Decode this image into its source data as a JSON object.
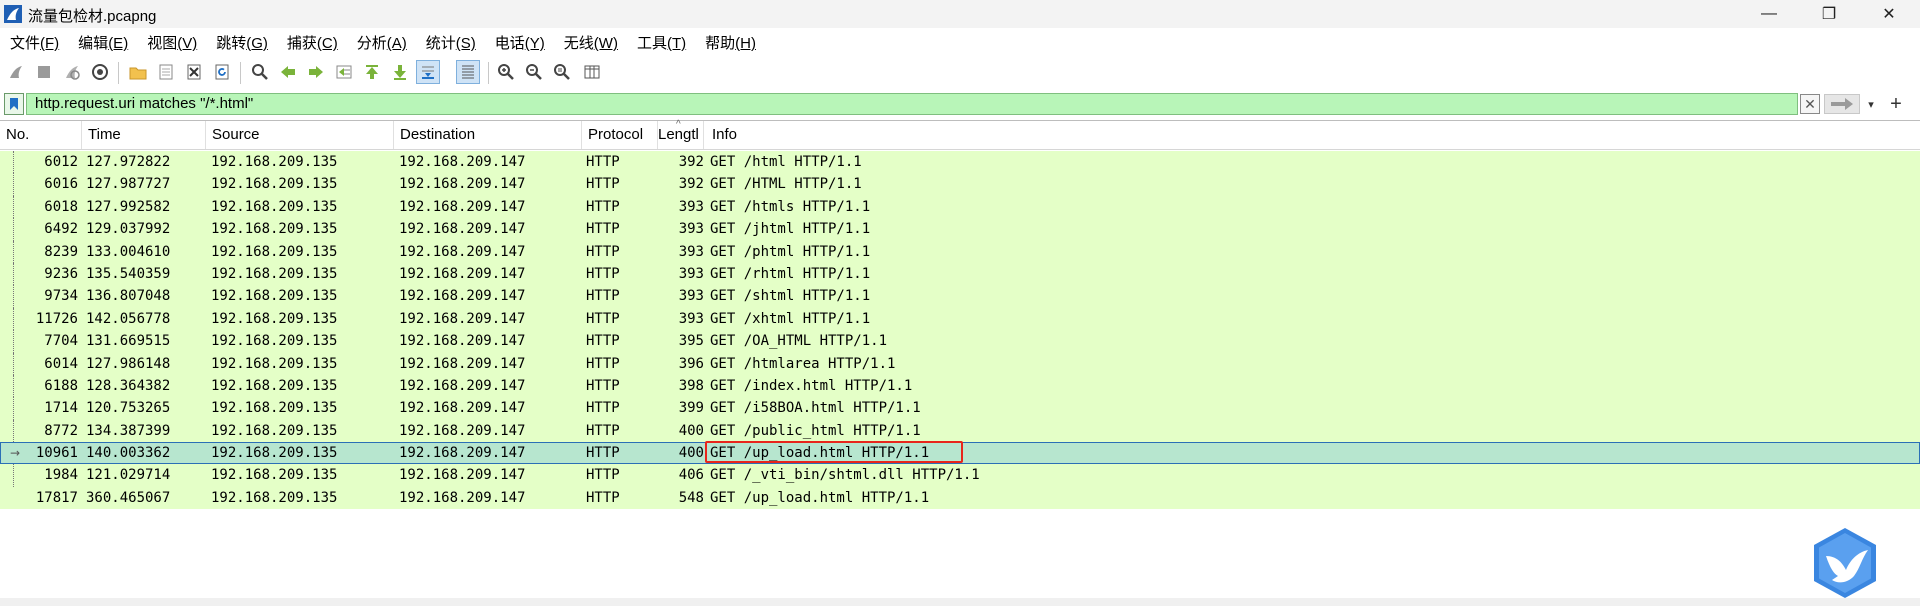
{
  "window": {
    "title": "流量包检材.pcapng",
    "controls": {
      "minimize": "—",
      "maximize": "❐",
      "close": "✕"
    }
  },
  "menu": [
    {
      "label": "文件",
      "mnemonic": "(F)"
    },
    {
      "label": "编辑",
      "mnemonic": "(E)"
    },
    {
      "label": "视图",
      "mnemonic": "(V)"
    },
    {
      "label": "跳转",
      "mnemonic": "(G)"
    },
    {
      "label": "捕获",
      "mnemonic": "(C)"
    },
    {
      "label": "分析",
      "mnemonic": "(A)"
    },
    {
      "label": "统计",
      "mnemonic": "(S)"
    },
    {
      "label": "电话",
      "mnemonic": "(Y)"
    },
    {
      "label": "无线",
      "mnemonic": "(W)"
    },
    {
      "label": "工具",
      "mnemonic": "(T)"
    },
    {
      "label": "帮助",
      "mnemonic": "(H)"
    }
  ],
  "toolbar": {
    "icons": [
      "start-capture-icon",
      "stop-capture-icon",
      "restart-capture-icon",
      "capture-options-icon",
      "open-file-icon",
      "save-file-icon",
      "close-file-icon",
      "reload-icon",
      "find-packet-icon",
      "go-back-icon",
      "go-forward-icon",
      "go-to-packet-icon",
      "go-first-icon",
      "go-last-icon",
      "autoscroll-icon",
      "colorize-icon",
      "zoom-in-icon",
      "zoom-out-icon",
      "normal-size-icon",
      "resize-columns-icon"
    ]
  },
  "filter": {
    "value": "http.request.uri matches \"/*.html\"",
    "clear_label": "✕",
    "plus_label": "+"
  },
  "packet_list": {
    "columns": [
      "No.",
      "Time",
      "Source",
      "Destination",
      "Protocol",
      "Lengtl",
      "Info"
    ],
    "rows": [
      {
        "no": "6012",
        "time": "127.972822",
        "src": "192.168.209.135",
        "dst": "192.168.209.147",
        "proto": "HTTP",
        "len": "392",
        "info": "GET /html HTTP/1.1"
      },
      {
        "no": "6016",
        "time": "127.987727",
        "src": "192.168.209.135",
        "dst": "192.168.209.147",
        "proto": "HTTP",
        "len": "392",
        "info": "GET /HTML HTTP/1.1"
      },
      {
        "no": "6018",
        "time": "127.992582",
        "src": "192.168.209.135",
        "dst": "192.168.209.147",
        "proto": "HTTP",
        "len": "393",
        "info": "GET /htmls HTTP/1.1"
      },
      {
        "no": "6492",
        "time": "129.037992",
        "src": "192.168.209.135",
        "dst": "192.168.209.147",
        "proto": "HTTP",
        "len": "393",
        "info": "GET /jhtml HTTP/1.1"
      },
      {
        "no": "8239",
        "time": "133.004610",
        "src": "192.168.209.135",
        "dst": "192.168.209.147",
        "proto": "HTTP",
        "len": "393",
        "info": "GET /phtml HTTP/1.1"
      },
      {
        "no": "9236",
        "time": "135.540359",
        "src": "192.168.209.135",
        "dst": "192.168.209.147",
        "proto": "HTTP",
        "len": "393",
        "info": "GET /rhtml HTTP/1.1"
      },
      {
        "no": "9734",
        "time": "136.807048",
        "src": "192.168.209.135",
        "dst": "192.168.209.147",
        "proto": "HTTP",
        "len": "393",
        "info": "GET /shtml HTTP/1.1"
      },
      {
        "no": "11726",
        "time": "142.056778",
        "src": "192.168.209.135",
        "dst": "192.168.209.147",
        "proto": "HTTP",
        "len": "393",
        "info": "GET /xhtml HTTP/1.1"
      },
      {
        "no": "7704",
        "time": "131.669515",
        "src": "192.168.209.135",
        "dst": "192.168.209.147",
        "proto": "HTTP",
        "len": "395",
        "info": "GET /OA_HTML HTTP/1.1"
      },
      {
        "no": "6014",
        "time": "127.986148",
        "src": "192.168.209.135",
        "dst": "192.168.209.147",
        "proto": "HTTP",
        "len": "396",
        "info": "GET /htmlarea HTTP/1.1"
      },
      {
        "no": "6188",
        "time": "128.364382",
        "src": "192.168.209.135",
        "dst": "192.168.209.147",
        "proto": "HTTP",
        "len": "398",
        "info": "GET /index.html HTTP/1.1"
      },
      {
        "no": "1714",
        "time": "120.753265",
        "src": "192.168.209.135",
        "dst": "192.168.209.147",
        "proto": "HTTP",
        "len": "399",
        "info": "GET /i58BOA.html HTTP/1.1"
      },
      {
        "no": "8772",
        "time": "134.387399",
        "src": "192.168.209.135",
        "dst": "192.168.209.147",
        "proto": "HTTP",
        "len": "400",
        "info": "GET /public_html HTTP/1.1"
      },
      {
        "no": "10961",
        "time": "140.003362",
        "src": "192.168.209.135",
        "dst": "192.168.209.147",
        "proto": "HTTP",
        "len": "400",
        "info": "GET /up_load.html HTTP/1.1",
        "selected": true
      },
      {
        "no": "1984",
        "time": "121.029714",
        "src": "192.168.209.135",
        "dst": "192.168.209.147",
        "proto": "HTTP",
        "len": "406",
        "info": "GET /_vti_bin/shtml.dll HTTP/1.1"
      },
      {
        "no": "17817",
        "time": "360.465067",
        "src": "192.168.209.135",
        "dst": "192.168.209.147",
        "proto": "HTTP",
        "len": "548",
        "info": "GET /up_load.html HTTP/1.1"
      }
    ]
  },
  "colors": {
    "row_bg": "#e4ffc7",
    "selected_bg": "#b7e6cf",
    "filter_bg": "#b8f5b8",
    "highlight": "#e8261c"
  }
}
